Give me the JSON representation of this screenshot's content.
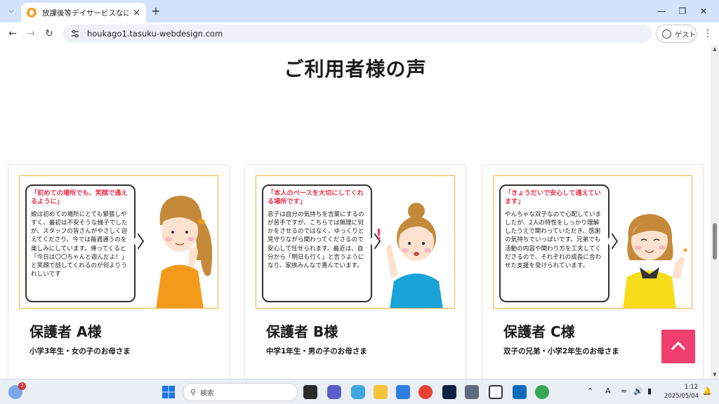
{
  "browser": {
    "tab_title": "放課後等デイサービスなにがし",
    "url": "houkago1.tasuku-webdesign.com",
    "guest_label": "ゲスト",
    "new_tab_label": "+",
    "close_tab_label": "×"
  },
  "page": {
    "section_title": "ご利用者様の声",
    "cards": [
      {
        "quote": "「初めての場所でも、笑顔で通えるように」",
        "body": "娘は初めての場所にとても緊張しやすく、最初は不安そうな様子でしたが、スタッフの皆さんがやさしく迎えてくださり、今では毎週通うのを楽しみにしています。帰ってくると「今日は〇〇ちゃんと遊んだよ！」と笑顔で話してくれるのが何よりうれしいです",
        "name": "保護者 A様",
        "role": "小学3年生・女の子のお母さま"
      },
      {
        "quote": "「本人のペースを大切にしてくれる場所です」",
        "body": "息子は自分の気持ちを言葉にするのが苦手ですが、こちらでは無理に何かをさせるのではなく、ゆっくりと見守りながら関わってくださるので安心して任せられます。最近は、自分から「明日も行く」と言うようになり、家族みんなで喜んでいます。",
        "name": "保護者 B様",
        "role": "中学1年生・男の子のお母さま"
      },
      {
        "quote": "「きょうだいで安心して通えています」",
        "body": "やんちゃな双子なので心配していましたが、2人の特性をしっかり理解したうえで関わっていただき、感謝の気持ちでいっぱいです。兄弟でも活動の内容や関わり方を工夫してくださるので、それぞれの成長に合わせた支援を受けられています。",
        "name": "保護者 C様",
        "role": "双子の兄弟・小学2年生のお母さま"
      }
    ]
  },
  "taskbar": {
    "search_placeholder": "検索",
    "notification_count": "2",
    "time": "1:12",
    "date": "2025/05/04"
  },
  "colors": {
    "accent_pink": "#ef3f6f",
    "quote_red": "#e8334a",
    "frame_orange": "#f2b13f",
    "tabbar_blue": "#d3e3fd"
  }
}
